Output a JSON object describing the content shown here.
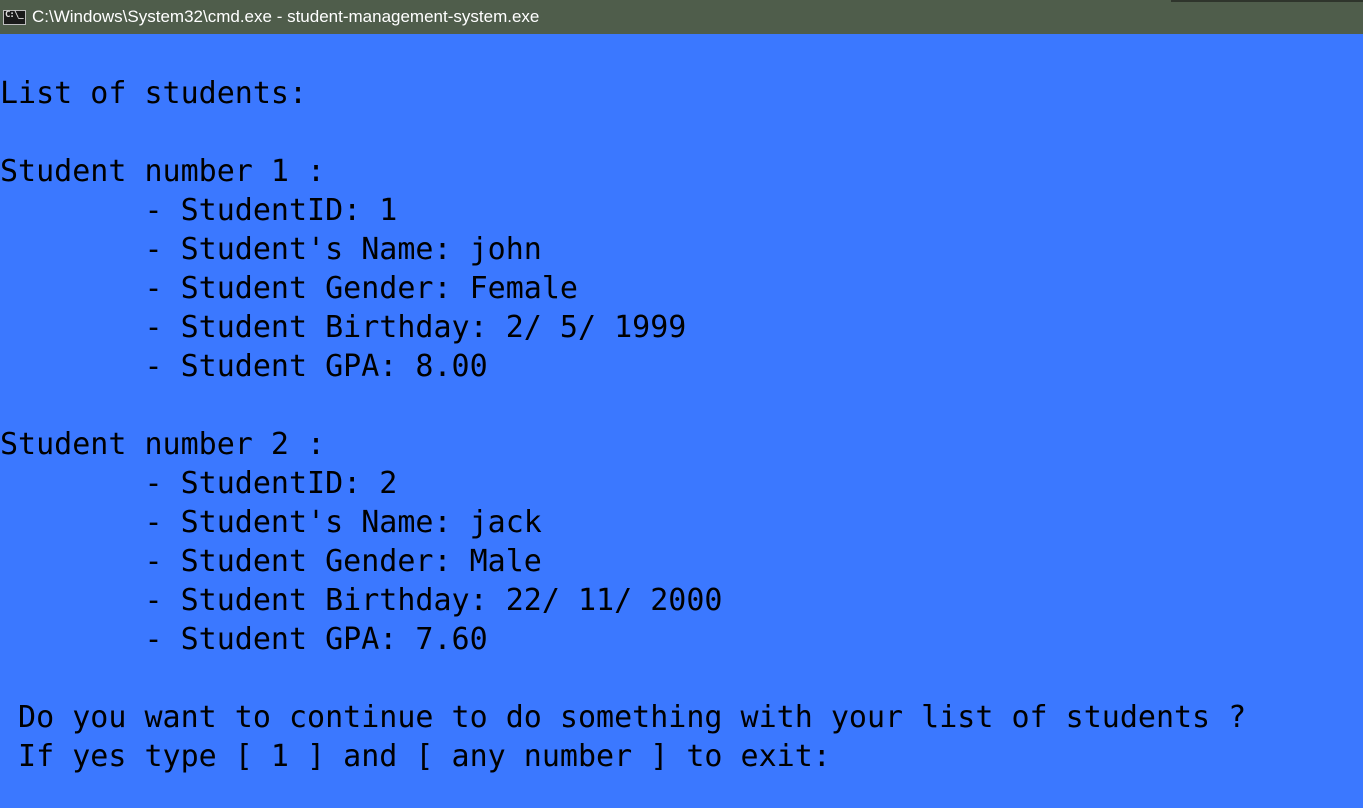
{
  "window": {
    "title": "C:\\Windows\\System32\\cmd.exe - student-management-system.exe",
    "icon": "cmd-icon",
    "background_color": "#3b78ff",
    "titlebar_color": "#4f5d4b"
  },
  "console": {
    "lines": [
      "List of students:",
      "",
      "Student number 1 :",
      "        - StudentID: 1",
      "        - Student's Name: john",
      "        - Student Gender: Female",
      "        - Student Birthday: 2/ 5/ 1999",
      "        - Student GPA: 8.00",
      "",
      "Student number 2 :",
      "        - StudentID: 2",
      "        - Student's Name: jack",
      "        - Student Gender: Male",
      "        - Student Birthday: 22/ 11/ 2000",
      "        - Student GPA: 7.60",
      "",
      " Do you want to continue to do something with your list of students ?",
      " If yes type [ 1 ] and [ any number ] to exit:"
    ]
  }
}
